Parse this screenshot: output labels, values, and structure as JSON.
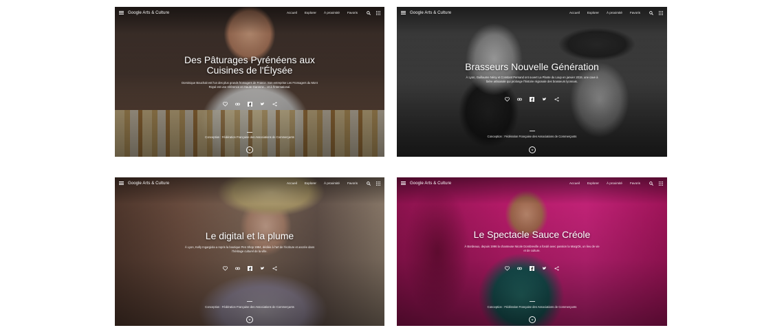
{
  "brand": "Google Arts & Culture",
  "nav": [
    "Accueil",
    "Explorer",
    "À proximité",
    "Favoris"
  ],
  "panels": [
    {
      "title_line1": "Des Pâturages Pyrénéens aux",
      "title_line2": "Cuisines de l'Élysée",
      "desc": "Dominique Bouchait est l'un des plus grands fromagers de France. Son entreprise Les Fromagers du Mont Royal est une référence en Haute-Garonne... et à l'international.",
      "credit": "Conception : Fédération Française des Associations de Commerçants"
    },
    {
      "title_line1": "Brasseurs Nouvelle Génération",
      "title_line2": "",
      "desc": "À Lyon, Guillaume Nény et Constant Persand ont ouvert La Plante du Loup en janvier 2019, une cave à bière artisanale qui prolonge l'histoire régionale des brasseurs lyonnais.",
      "credit": "Conception : Fédération Française des Associations de Commerçants"
    },
    {
      "title_line1": "Le digital et la plume",
      "title_line2": "",
      "desc": "À Lyon, Kelly Ingargiola a repris la boutique Pen Shop 1984, dédiée à l'art de l'écriture et ancrée dans l'héritage culturel de la ville.",
      "credit": "Conception : Fédération Française des Associations de Commerçants"
    },
    {
      "title_line1": "Le Spectacle Sauce Créole",
      "title_line2": "",
      "desc": "À Bordeaux, depuis 1996 la chanteuse Nicole Dombreville a fondé avec passion la MargOk, un lieu de vie et de culture.",
      "credit": "Conception : Fédération Française des Associations de Commerçants"
    }
  ],
  "colors": {
    "panel1": "#5b4a3a",
    "panel2": "#3b3b3b",
    "panel3": "#6b5a4c",
    "panel4": "#c2186e"
  }
}
